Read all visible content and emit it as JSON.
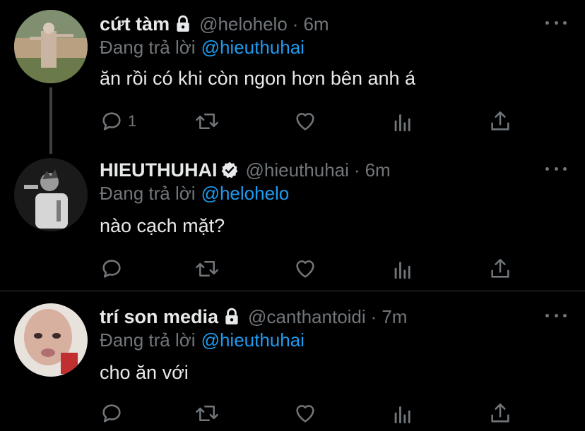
{
  "tweets": [
    {
      "display_name": "cứt tàm",
      "badge": "lock-icon",
      "handle": "@helohelo",
      "separator": "·",
      "time": "6m",
      "reply_prefix": "Đang trả lời",
      "reply_mention": "@hieuthuhai",
      "text": "ăn rồi có khi còn ngon hơn bên anh á",
      "reply_count": "1"
    },
    {
      "display_name": "HIEUTHUHAI",
      "badge": "verified-badge-icon",
      "handle": "@hieuthuhai",
      "separator": "·",
      "time": "6m",
      "reply_prefix": "Đang trả lời",
      "reply_mention": "@helohelo",
      "text": "nào cạch mặt?",
      "reply_count": ""
    },
    {
      "display_name": "trí son media",
      "badge": "lock-icon",
      "handle": "@canthantoidi",
      "separator": "·",
      "time": "7m",
      "reply_prefix": "Đang trả lời",
      "reply_mention": "@hieuthuhai",
      "text": "cho ăn với",
      "reply_count": ""
    }
  ],
  "colors": {
    "background": "#000000",
    "text": "#e7e9ea",
    "muted": "#71767b",
    "mention": "#1d9bf0",
    "divider": "#2f3336",
    "thread_line": "#3d4144"
  },
  "action_icons": [
    "reply-icon",
    "retweet-icon",
    "like-icon",
    "analytics-icon",
    "share-icon"
  ]
}
